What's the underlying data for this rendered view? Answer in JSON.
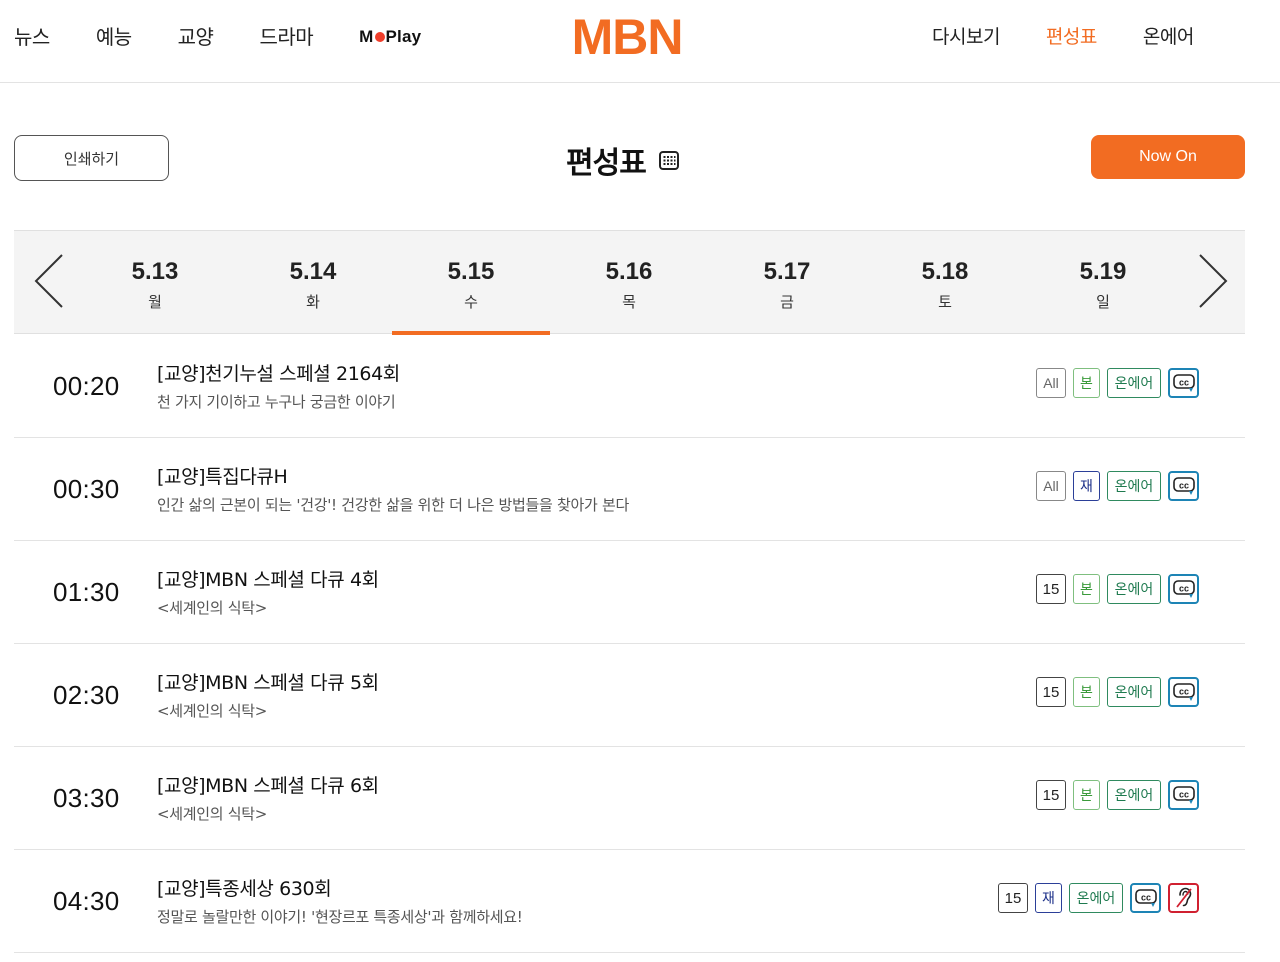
{
  "header": {
    "nav_left": [
      "뉴스",
      "예능",
      "교양",
      "드라마"
    ],
    "moplay": {
      "pre": "M",
      "post": "Play"
    },
    "logo_text": "MBN",
    "nav_right": [
      "다시보기",
      "편성표",
      "온에어"
    ],
    "active_right": "편성표"
  },
  "toolbar": {
    "print_label": "인쇄하기",
    "page_title": "편성표",
    "now_on_label": "Now On"
  },
  "dates": [
    {
      "date": "5.13",
      "weekday": "월"
    },
    {
      "date": "5.14",
      "weekday": "화"
    },
    {
      "date": "5.15",
      "weekday": "수"
    },
    {
      "date": "5.16",
      "weekday": "목"
    },
    {
      "date": "5.17",
      "weekday": "금"
    },
    {
      "date": "5.18",
      "weekday": "토"
    },
    {
      "date": "5.19",
      "weekday": "일"
    }
  ],
  "selected_date": "5.15",
  "schedule": [
    {
      "time": "00:20",
      "title": "[교양]천기누설 스페셜 2164회",
      "desc": "천 가지 기이하고 누구나 궁금한 이야기",
      "rating": "All",
      "type": "본",
      "onair": "온에어"
    },
    {
      "time": "00:30",
      "title": "[교양]특집다큐H",
      "desc": "인간 삶의 근본이 되는 '건강'! 건강한 삶을 위한 더 나은 방법들을 찾아가 본다",
      "rating": "All",
      "type": "재",
      "onair": "온에어"
    },
    {
      "time": "01:30",
      "title": "[교양]MBN 스페셜 다큐 4회",
      "desc": "<세계인의 식탁>",
      "rating": "15",
      "type": "본",
      "onair": "온에어"
    },
    {
      "time": "02:30",
      "title": "[교양]MBN 스페셜 다큐 5회",
      "desc": "<세계인의 식탁>",
      "rating": "15",
      "type": "본",
      "onair": "온에어"
    },
    {
      "time": "03:30",
      "title": "[교양]MBN 스페셜 다큐 6회",
      "desc": "<세계인의 식탁>",
      "rating": "15",
      "type": "본",
      "onair": "온에어"
    },
    {
      "time": "04:30",
      "title": "[교양]특종세상 630회",
      "desc": "정말로 놀랄만한 이야기! '현장르포 특종세상'과 함께하세요!",
      "rating": "15",
      "type": "재",
      "onair": "온에어"
    }
  ],
  "colors": {
    "accent": "#f26c22",
    "onair": "#2f8a5f",
    "cc": "#1d84b5",
    "ear": "#d02030"
  }
}
